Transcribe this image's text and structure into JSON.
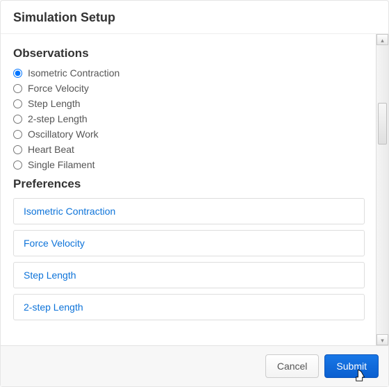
{
  "header": {
    "title": "Simulation Setup"
  },
  "sections": {
    "observations_label": "Observations",
    "preferences_label": "Preferences"
  },
  "observations": {
    "selected_index": 0,
    "options": [
      "Isometric Contraction",
      "Force Velocity",
      "Step Length",
      "2-step Length",
      "Oscillatory Work",
      "Heart Beat",
      "Single Filament"
    ]
  },
  "preferences": {
    "items": [
      "Isometric Contraction",
      "Force Velocity",
      "Step Length",
      "2-step Length"
    ]
  },
  "footer": {
    "cancel_label": "Cancel",
    "submit_label": "Submit"
  }
}
